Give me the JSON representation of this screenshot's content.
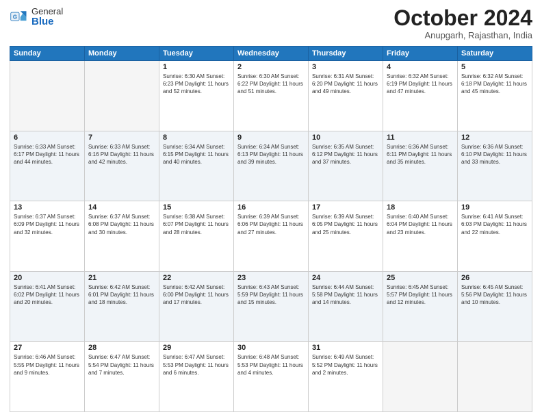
{
  "logo": {
    "general": "General",
    "blue": "Blue"
  },
  "header": {
    "month": "October 2024",
    "location": "Anupgarh, Rajasthan, India"
  },
  "days_of_week": [
    "Sunday",
    "Monday",
    "Tuesday",
    "Wednesday",
    "Thursday",
    "Friday",
    "Saturday"
  ],
  "weeks": [
    [
      {
        "day": "",
        "info": ""
      },
      {
        "day": "",
        "info": ""
      },
      {
        "day": "1",
        "info": "Sunrise: 6:30 AM\nSunset: 6:23 PM\nDaylight: 11 hours and 52 minutes."
      },
      {
        "day": "2",
        "info": "Sunrise: 6:30 AM\nSunset: 6:22 PM\nDaylight: 11 hours and 51 minutes."
      },
      {
        "day": "3",
        "info": "Sunrise: 6:31 AM\nSunset: 6:20 PM\nDaylight: 11 hours and 49 minutes."
      },
      {
        "day": "4",
        "info": "Sunrise: 6:32 AM\nSunset: 6:19 PM\nDaylight: 11 hours and 47 minutes."
      },
      {
        "day": "5",
        "info": "Sunrise: 6:32 AM\nSunset: 6:18 PM\nDaylight: 11 hours and 45 minutes."
      }
    ],
    [
      {
        "day": "6",
        "info": "Sunrise: 6:33 AM\nSunset: 6:17 PM\nDaylight: 11 hours and 44 minutes."
      },
      {
        "day": "7",
        "info": "Sunrise: 6:33 AM\nSunset: 6:16 PM\nDaylight: 11 hours and 42 minutes."
      },
      {
        "day": "8",
        "info": "Sunrise: 6:34 AM\nSunset: 6:15 PM\nDaylight: 11 hours and 40 minutes."
      },
      {
        "day": "9",
        "info": "Sunrise: 6:34 AM\nSunset: 6:13 PM\nDaylight: 11 hours and 39 minutes."
      },
      {
        "day": "10",
        "info": "Sunrise: 6:35 AM\nSunset: 6:12 PM\nDaylight: 11 hours and 37 minutes."
      },
      {
        "day": "11",
        "info": "Sunrise: 6:36 AM\nSunset: 6:11 PM\nDaylight: 11 hours and 35 minutes."
      },
      {
        "day": "12",
        "info": "Sunrise: 6:36 AM\nSunset: 6:10 PM\nDaylight: 11 hours and 33 minutes."
      }
    ],
    [
      {
        "day": "13",
        "info": "Sunrise: 6:37 AM\nSunset: 6:09 PM\nDaylight: 11 hours and 32 minutes."
      },
      {
        "day": "14",
        "info": "Sunrise: 6:37 AM\nSunset: 6:08 PM\nDaylight: 11 hours and 30 minutes."
      },
      {
        "day": "15",
        "info": "Sunrise: 6:38 AM\nSunset: 6:07 PM\nDaylight: 11 hours and 28 minutes."
      },
      {
        "day": "16",
        "info": "Sunrise: 6:39 AM\nSunset: 6:06 PM\nDaylight: 11 hours and 27 minutes."
      },
      {
        "day": "17",
        "info": "Sunrise: 6:39 AM\nSunset: 6:05 PM\nDaylight: 11 hours and 25 minutes."
      },
      {
        "day": "18",
        "info": "Sunrise: 6:40 AM\nSunset: 6:04 PM\nDaylight: 11 hours and 23 minutes."
      },
      {
        "day": "19",
        "info": "Sunrise: 6:41 AM\nSunset: 6:03 PM\nDaylight: 11 hours and 22 minutes."
      }
    ],
    [
      {
        "day": "20",
        "info": "Sunrise: 6:41 AM\nSunset: 6:02 PM\nDaylight: 11 hours and 20 minutes."
      },
      {
        "day": "21",
        "info": "Sunrise: 6:42 AM\nSunset: 6:01 PM\nDaylight: 11 hours and 18 minutes."
      },
      {
        "day": "22",
        "info": "Sunrise: 6:42 AM\nSunset: 6:00 PM\nDaylight: 11 hours and 17 minutes."
      },
      {
        "day": "23",
        "info": "Sunrise: 6:43 AM\nSunset: 5:59 PM\nDaylight: 11 hours and 15 minutes."
      },
      {
        "day": "24",
        "info": "Sunrise: 6:44 AM\nSunset: 5:58 PM\nDaylight: 11 hours and 14 minutes."
      },
      {
        "day": "25",
        "info": "Sunrise: 6:45 AM\nSunset: 5:57 PM\nDaylight: 11 hours and 12 minutes."
      },
      {
        "day": "26",
        "info": "Sunrise: 6:45 AM\nSunset: 5:56 PM\nDaylight: 11 hours and 10 minutes."
      }
    ],
    [
      {
        "day": "27",
        "info": "Sunrise: 6:46 AM\nSunset: 5:55 PM\nDaylight: 11 hours and 9 minutes."
      },
      {
        "day": "28",
        "info": "Sunrise: 6:47 AM\nSunset: 5:54 PM\nDaylight: 11 hours and 7 minutes."
      },
      {
        "day": "29",
        "info": "Sunrise: 6:47 AM\nSunset: 5:53 PM\nDaylight: 11 hours and 6 minutes."
      },
      {
        "day": "30",
        "info": "Sunrise: 6:48 AM\nSunset: 5:53 PM\nDaylight: 11 hours and 4 minutes."
      },
      {
        "day": "31",
        "info": "Sunrise: 6:49 AM\nSunset: 5:52 PM\nDaylight: 11 hours and 2 minutes."
      },
      {
        "day": "",
        "info": ""
      },
      {
        "day": "",
        "info": ""
      }
    ]
  ]
}
